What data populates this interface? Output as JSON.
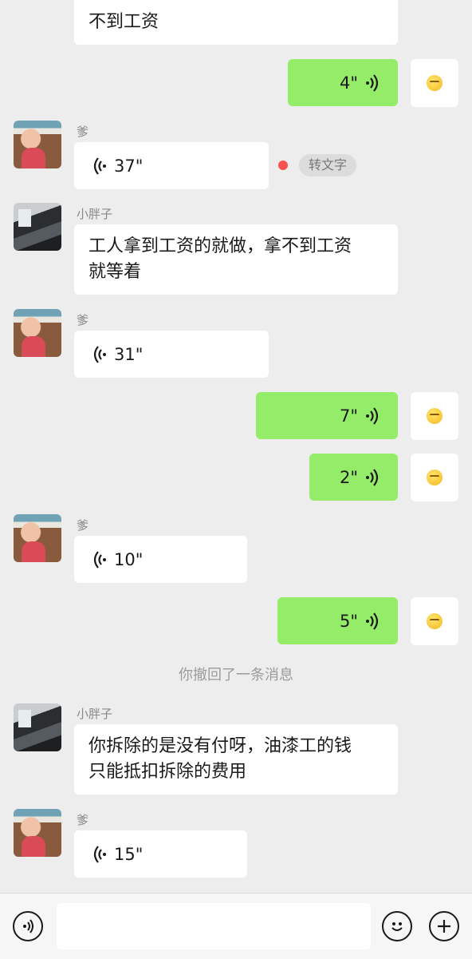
{
  "messages": {
    "m1": {
      "text": "不到工资"
    },
    "m2": {
      "duration": "4\""
    },
    "m3": {
      "sender": "爹",
      "duration": "37\"",
      "action": "转文字"
    },
    "m4": {
      "sender": "小胖子",
      "text_line1": "工人拿到工资的就做，拿不到工资",
      "text_line2": "就等着"
    },
    "m5": {
      "sender": "爹",
      "duration": "31\""
    },
    "m6": {
      "duration": "7\""
    },
    "m7": {
      "duration": "2\""
    },
    "m8": {
      "sender": "爹",
      "duration": "10\""
    },
    "m9": {
      "duration": "5\""
    },
    "recall": "你撤回了一条消息",
    "m10": {
      "sender": "小胖子",
      "text_line1": "你拆除的是没有付呀，油漆工的钱",
      "text_line2": "只能抵扣拆除的费用"
    },
    "m11": {
      "sender": "爹",
      "duration": "15\""
    }
  },
  "colors": {
    "outgoing_bubble": "#95ec69",
    "incoming_bubble": "#ffffff",
    "background": "#ededed",
    "unread_dot": "#fa5151"
  },
  "icons": {
    "voice_in": "voice-wave-icon",
    "voice_out": "voice-wave-icon",
    "voice_mode": "voice-mode-icon",
    "emoji": "smiley-face-icon",
    "more": "plus-circle-icon",
    "my_avatar": "sleepy-emoji-icon"
  }
}
